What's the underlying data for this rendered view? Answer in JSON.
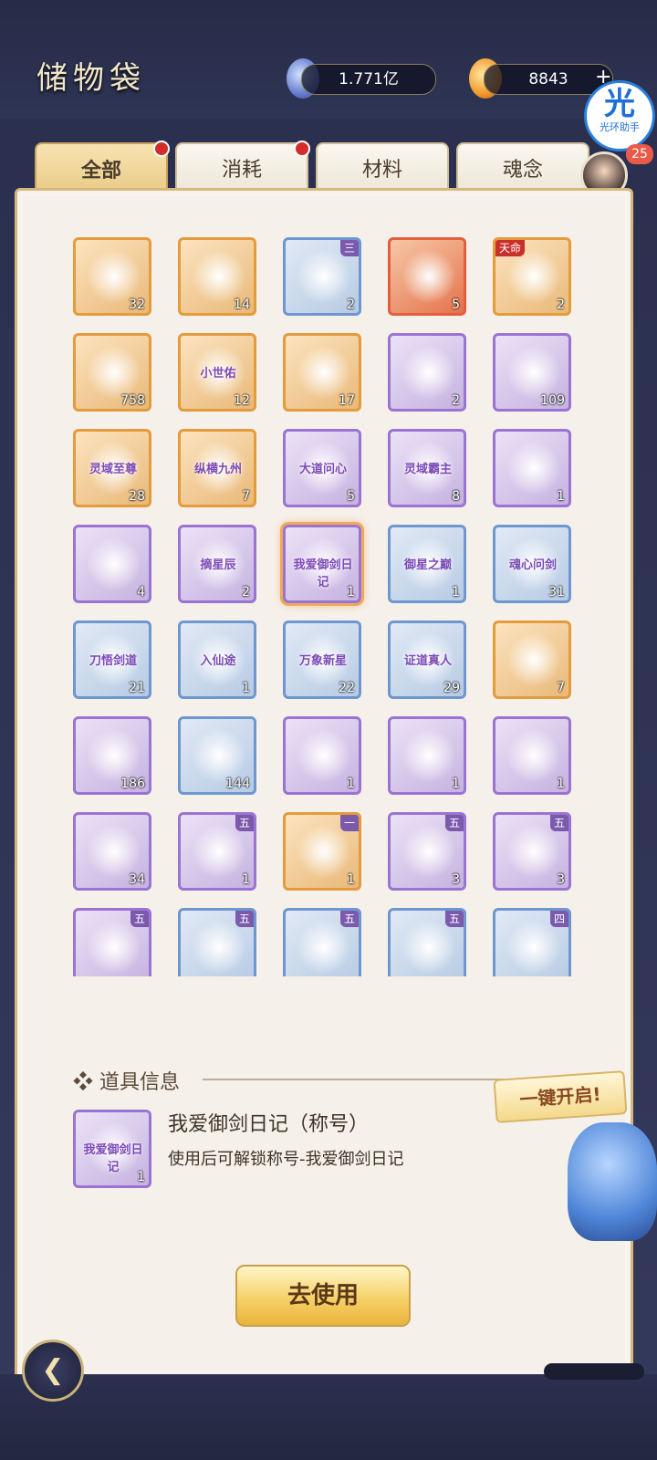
{
  "header": {
    "title": "储物袋",
    "currency1": "1.771亿",
    "currency2": "8843",
    "plus": "+"
  },
  "assistant": {
    "glyph": "光",
    "label": "光环助手",
    "badge": "25"
  },
  "tabs": [
    {
      "label": "全部",
      "active": true,
      "dot": true
    },
    {
      "label": "消耗",
      "active": false,
      "dot": true
    },
    {
      "label": "材料",
      "active": false,
      "dot": false
    },
    {
      "label": "魂念",
      "active": false,
      "dot": false
    }
  ],
  "items": [
    {
      "count": "32",
      "quality": "orange"
    },
    {
      "count": "14",
      "quality": "orange"
    },
    {
      "count": "2",
      "quality": "blue",
      "tier": "三"
    },
    {
      "count": "5",
      "quality": "red"
    },
    {
      "count": "2",
      "quality": "orange",
      "tag": "天命"
    },
    {
      "count": "758",
      "quality": "orange"
    },
    {
      "count": "12",
      "quality": "orange",
      "banner": "小世佑"
    },
    {
      "count": "17",
      "quality": "orange"
    },
    {
      "count": "2",
      "quality": "purple"
    },
    {
      "count": "109",
      "quality": "purple"
    },
    {
      "count": "28",
      "quality": "orange",
      "banner": "灵域至尊"
    },
    {
      "count": "7",
      "quality": "orange",
      "banner": "纵横九州"
    },
    {
      "count": "5",
      "quality": "purple",
      "banner": "大道问心"
    },
    {
      "count": "8",
      "quality": "purple",
      "banner": "灵域霸主"
    },
    {
      "count": "1",
      "quality": "purple"
    },
    {
      "count": "4",
      "quality": "purple"
    },
    {
      "count": "2",
      "quality": "purple",
      "banner": "摘星辰"
    },
    {
      "count": "1",
      "quality": "purple",
      "banner": "我爱御剑日记",
      "selected": true
    },
    {
      "count": "1",
      "quality": "blue",
      "banner": "御星之巅"
    },
    {
      "count": "31",
      "quality": "blue",
      "banner": "魂心问剑"
    },
    {
      "count": "21",
      "quality": "blue",
      "banner": "刀悟剑道"
    },
    {
      "count": "1",
      "quality": "blue",
      "banner": "入仙途"
    },
    {
      "count": "22",
      "quality": "blue",
      "banner": "万象新星"
    },
    {
      "count": "29",
      "quality": "blue",
      "banner": "证道真人"
    },
    {
      "count": "7",
      "quality": "orange"
    },
    {
      "count": "186",
      "quality": "purple"
    },
    {
      "count": "144",
      "quality": "blue"
    },
    {
      "count": "1",
      "quality": "purple"
    },
    {
      "count": "1",
      "quality": "purple"
    },
    {
      "count": "1",
      "quality": "purple"
    },
    {
      "count": "34",
      "quality": "purple"
    },
    {
      "count": "1",
      "quality": "purple",
      "tier": "五"
    },
    {
      "count": "1",
      "quality": "orange",
      "tier": "一"
    },
    {
      "count": "3",
      "quality": "purple",
      "tier": "五"
    },
    {
      "count": "3",
      "quality": "purple",
      "tier": "五"
    },
    {
      "count": "",
      "quality": "purple",
      "tier": "五"
    },
    {
      "count": "",
      "quality": "blue",
      "tier": "五"
    },
    {
      "count": "",
      "quality": "blue",
      "tier": "五"
    },
    {
      "count": "",
      "quality": "blue",
      "tier": "五"
    },
    {
      "count": "",
      "quality": "blue",
      "tier": "四"
    }
  ],
  "info": {
    "heading": "❖ 道具信息",
    "name": "我爱御剑日记（称号）",
    "desc": "使用后可解锁称号-我爱御剑日记",
    "icon_banner": "我爱御剑日记",
    "icon_count": "1",
    "one_key": "一键开启!",
    "use_button": "去使用"
  },
  "nav": {
    "back_icon": "back-arrow-icon"
  }
}
